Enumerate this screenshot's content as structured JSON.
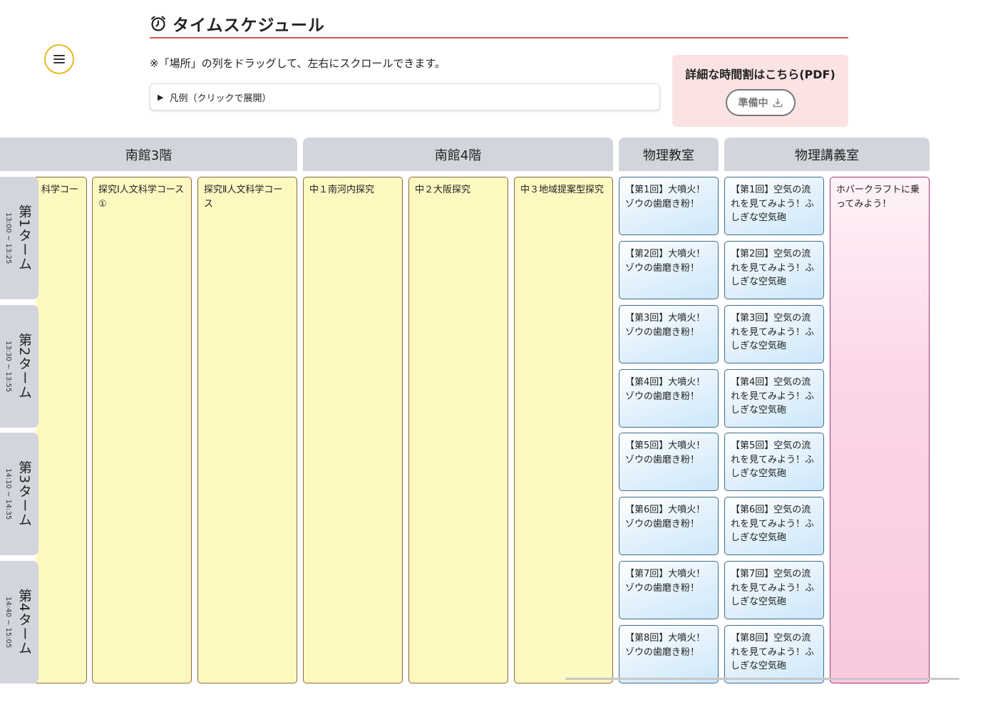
{
  "header": {
    "title": "タイムスケジュール",
    "note": "※「場所」の列をドラッグして、左右にスクロールできます。",
    "legend_label": "凡例（クリックで展開）"
  },
  "pdf": {
    "title": "詳細な時間割はこちら(PDF)",
    "button_label": "準備中"
  },
  "locations": [
    "南館3階",
    "南館4階",
    "物理教室",
    "物理講義室"
  ],
  "terms": [
    {
      "name": "第1ターム",
      "time": "13:00 ~ 13:25"
    },
    {
      "name": "第2ターム",
      "time": "13:30 ~ 13:55"
    },
    {
      "name": "第3ターム",
      "time": "14:10 ~ 14:35"
    },
    {
      "name": "第4ターム",
      "time": "14:40 ~ 15:05"
    }
  ],
  "events": {
    "s3_col1": "科学コー",
    "s3_col2": "探究Ⅰ人文科学コース①",
    "s3_col3": "探究Ⅱ人文科学コース",
    "s4_col1": "中１南河内探究",
    "s4_col2": "中２大阪探究",
    "s4_col3": "中３地域提案型探究",
    "physics_room": [
      "【第1回】大噴火！ゾウの歯磨き粉！",
      "【第2回】大噴火！ゾウの歯磨き粉！",
      "【第3回】大噴火！ゾウの歯磨き粉！",
      "【第4回】大噴火！ゾウの歯磨き粉！",
      "【第5回】大噴火！ゾウの歯磨き粉！",
      "【第6回】大噴火！ゾウの歯磨き粉！",
      "【第7回】大噴火！ゾウの歯磨き粉！",
      "【第8回】大噴火！ゾウの歯磨き粉！"
    ],
    "physics_lecture": [
      "【第1回】空気の流れを見てみよう！ふしぎな空気砲",
      "【第2回】空気の流れを見てみよう！ふしぎな空気砲",
      "【第3回】空気の流れを見てみよう！ふしぎな空気砲",
      "【第4回】空気の流れを見てみよう！ふしぎな空気砲",
      "【第5回】空気の流れを見てみよう！ふしぎな空気砲",
      "【第6回】空気の流れを見てみよう！ふしぎな空気砲",
      "【第7回】空気の流れを見てみよう！ふしぎな空気砲",
      "【第8回】空気の流れを見てみよう！ふしぎな空気砲"
    ],
    "hovercraft": "ホバークラフトに乗ってみよう！"
  },
  "colors": {
    "menu_border": "#e8b923",
    "title_underline": "#d9534f",
    "pdf_bg": "#fbe3e3",
    "header_bg": "#d2d5db",
    "yellow_event": "#fdf7c0",
    "blue_event": "#cde7f9",
    "pink_event": "#f9c9dd"
  }
}
